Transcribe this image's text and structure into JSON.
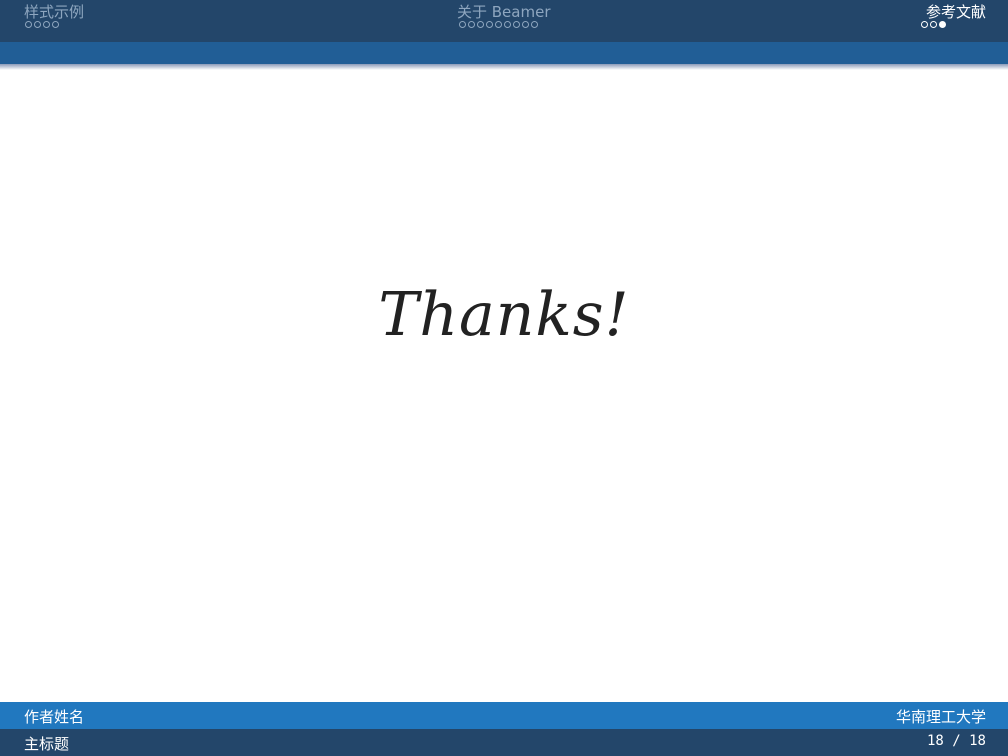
{
  "header": {
    "sections": [
      {
        "label": "样式示例",
        "dots": 4,
        "current": -1
      },
      {
        "label": "关于 Beamer",
        "dots": 9,
        "current": -1
      },
      {
        "label": "参考文献",
        "dots": 3,
        "current": 2
      }
    ]
  },
  "slide": {
    "text": "Thanks!"
  },
  "footer": {
    "author": "作者姓名",
    "institute": "华南理工大学",
    "title": "主标题",
    "page": "18 / 18"
  }
}
